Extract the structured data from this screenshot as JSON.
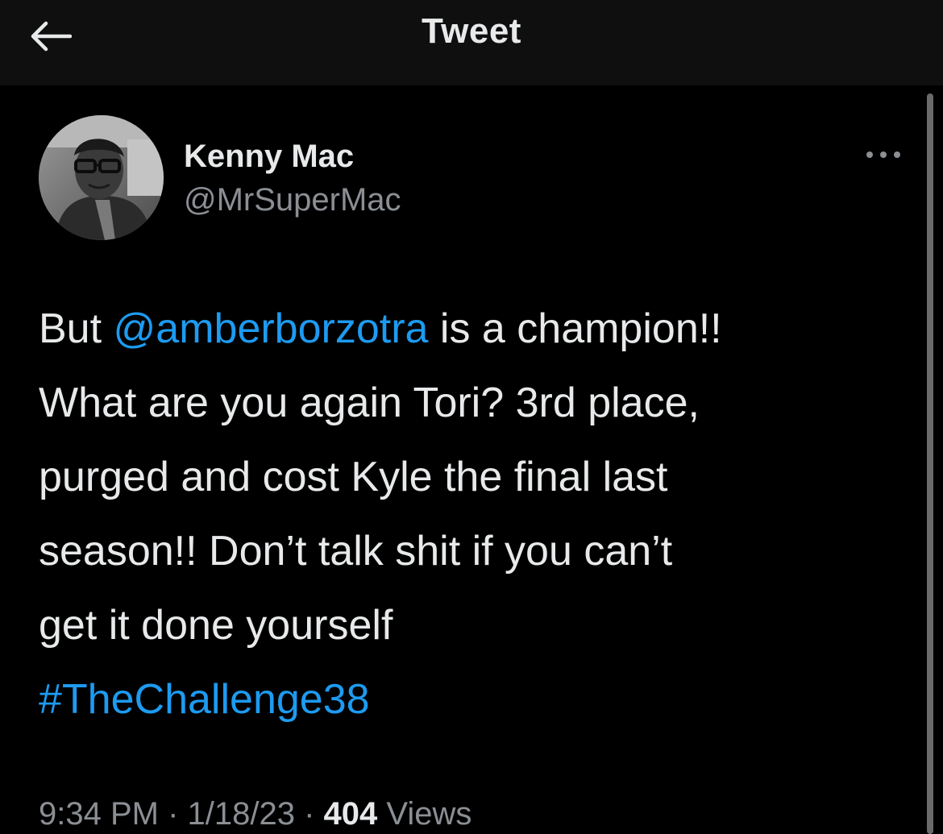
{
  "header": {
    "title": "Tweet",
    "back_icon": "arrow-left-icon"
  },
  "author": {
    "name": "Kenny Mac",
    "handle": "@MrSuperMac",
    "avatar_icon": "avatar-photo",
    "more_icon": "more-horizontal-icon"
  },
  "tweet": {
    "line1_pre": "But ",
    "mention": "@amberborzotra",
    "line1_post": " is a champion!!",
    "body": "What are you again Tori? 3rd place,\npurged and cost Kyle the final last\nseason!! Don’t talk shit if you can’t\nget it done yourself",
    "hashtag": "#TheChallenge38"
  },
  "meta": {
    "time": "9:34 PM",
    "sep1": " · ",
    "date": "1/18/23",
    "sep2": " · ",
    "views_count": "404",
    "views_label": " Views"
  },
  "colors": {
    "background": "#000000",
    "header_bg": "#0f0f0f",
    "text": "#e7e9ea",
    "secondary": "#8b8f94",
    "link": "#1d9bf0"
  }
}
